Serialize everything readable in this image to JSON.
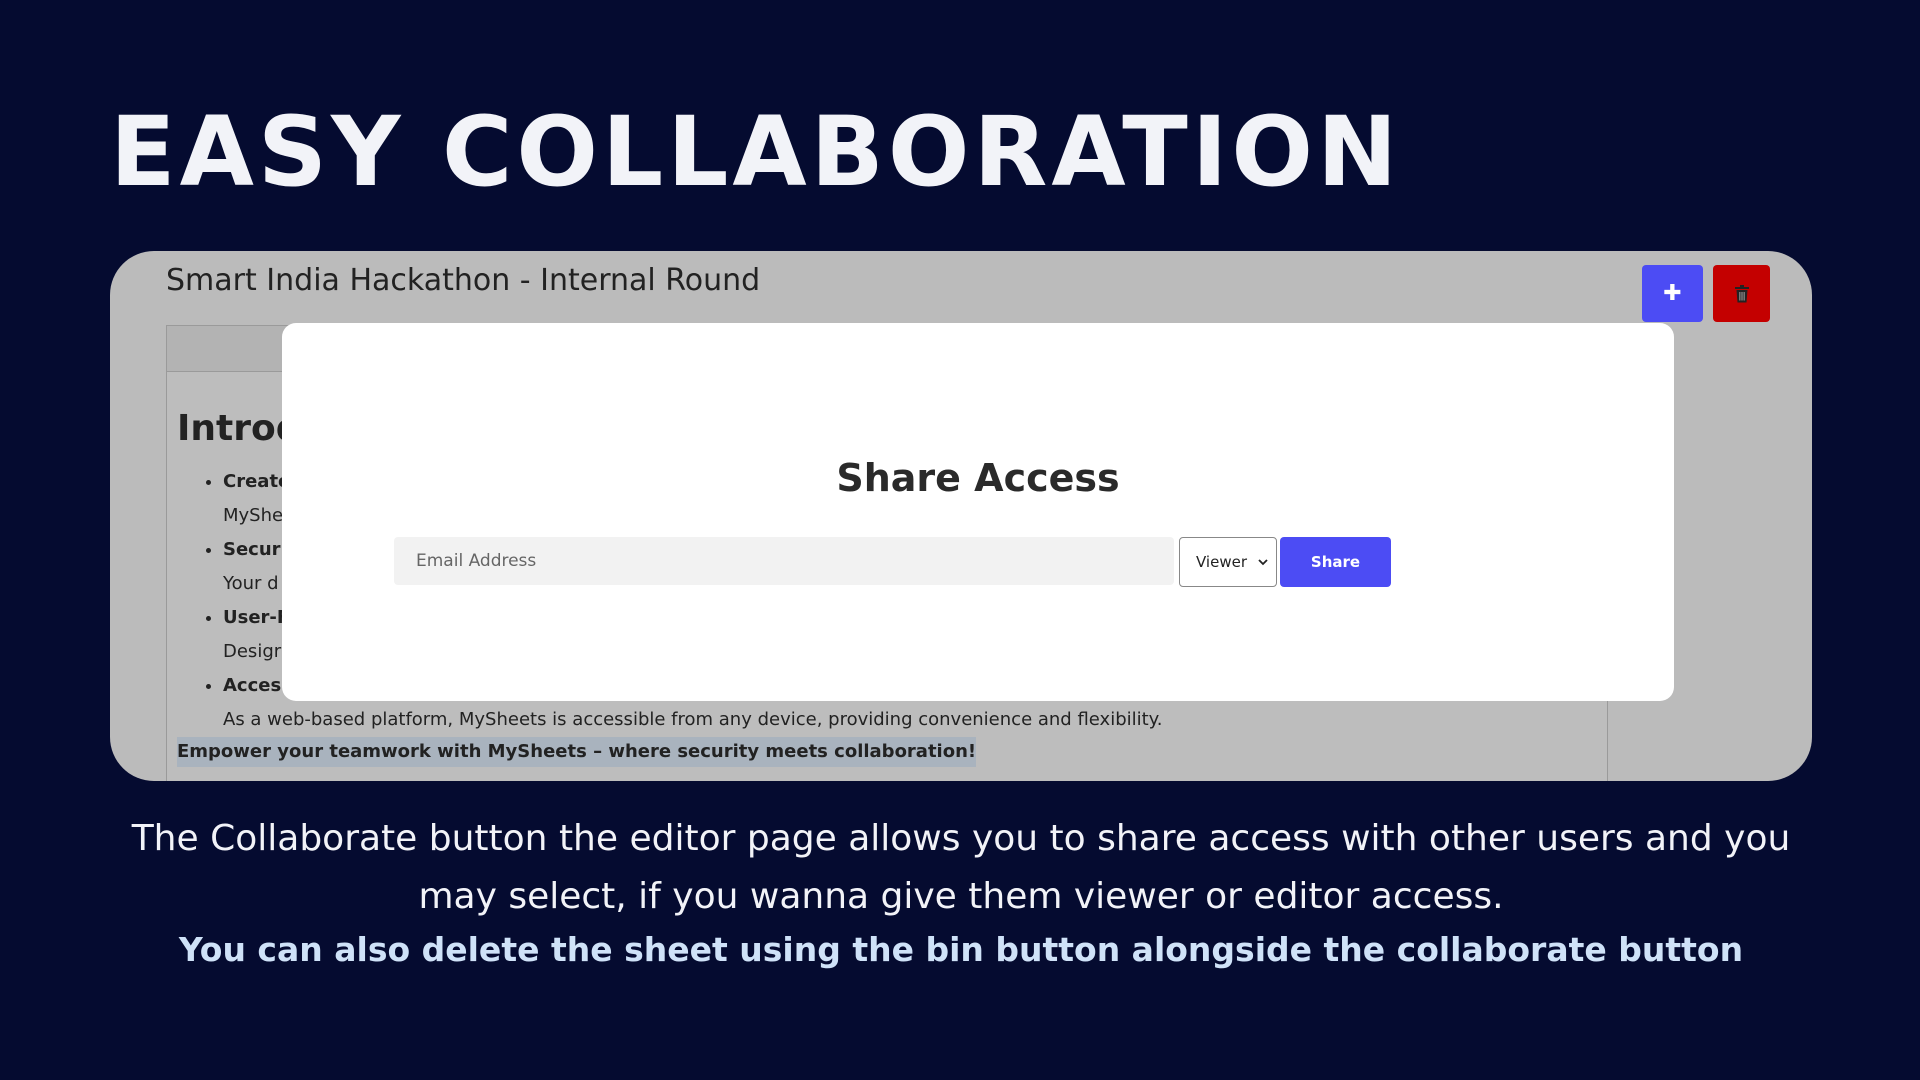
{
  "slide": {
    "title": "EASY COLLABORATION",
    "caption": "The Collaborate button the editor page allows you to share access with other users and you may select, if you wanna give them viewer or editor access.",
    "caption_bold": "You can also delete the sheet using the bin button alongside the collaborate button"
  },
  "editor": {
    "doc_title": "Smart India Hackathon - Internal Round",
    "add_icon": "plus-icon",
    "delete_icon": "trash-icon",
    "heading_visible": "Introd",
    "bullets": [
      {
        "head": "Create",
        "body": "MyShe"
      },
      {
        "head": "Securi",
        "body": "Your d"
      },
      {
        "head": "User-F",
        "body": "Desigr"
      },
      {
        "head": "Acces",
        "body": "As a web-based platform, MySheets is accessible from any device, providing convenience and flexibility."
      }
    ],
    "closing": "Empower your teamwork with MySheets – where security meets collaboration!"
  },
  "modal": {
    "title": "Share Access",
    "email_placeholder": "Email Address",
    "email_value": "",
    "role_selected": "Viewer",
    "share_label": "Share"
  },
  "colors": {
    "background": "#050b30",
    "accent": "#4c4cf4",
    "danger": "#c40000"
  }
}
